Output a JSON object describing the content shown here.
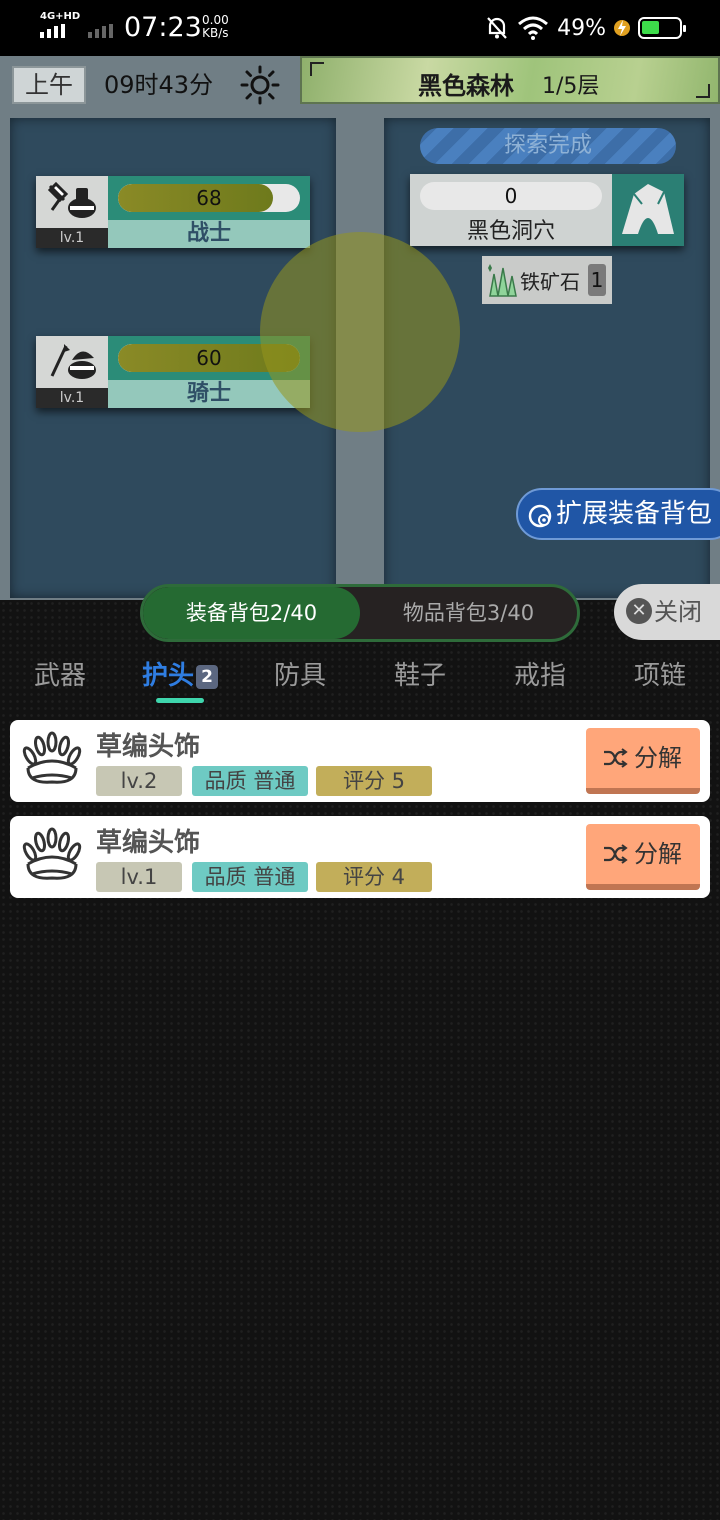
{
  "status_bar": {
    "network": "4G+HD",
    "time": "07:23",
    "speed_value": "0.00",
    "speed_unit": "KB/s",
    "battery_percent": "49%",
    "battery_level": 0.49
  },
  "header": {
    "period": "上午",
    "clock": "09时43分",
    "zone_name": "黑色森林",
    "zone_floor": "1/5层"
  },
  "heroes": [
    {
      "name": "战士",
      "level": "lv.1",
      "value": "68",
      "fill": 0.85
    },
    {
      "name": "骑士",
      "level": "lv.1",
      "value": "60",
      "fill": 1.0
    }
  ],
  "exploration": {
    "status": "探索完成",
    "location_value": "0",
    "location_name": "黑色洞穴",
    "loot_name": "铁矿石",
    "loot_count": "1"
  },
  "expand_button": "扩展装备背包",
  "bag_tabs": {
    "equipment": "装备背包2/40",
    "items": "物品背包3/40"
  },
  "close_button": "关闭",
  "categories": [
    {
      "label": "武器"
    },
    {
      "label": "护头",
      "badge": "2"
    },
    {
      "label": "防具"
    },
    {
      "label": "鞋子"
    },
    {
      "label": "戒指"
    },
    {
      "label": "项链"
    }
  ],
  "items": [
    {
      "name": "草编头饰",
      "level": "lv.2",
      "quality": "品质 普通",
      "score": "评分 5",
      "action": "分解"
    },
    {
      "name": "草编头饰",
      "level": "lv.1",
      "quality": "品质 普通",
      "score": "评分 4",
      "action": "分解"
    }
  ],
  "colors": {
    "accent_green": "#256a32",
    "active_tab_blue": "#2f7de1",
    "decompose_orange": "#ffa67a"
  }
}
